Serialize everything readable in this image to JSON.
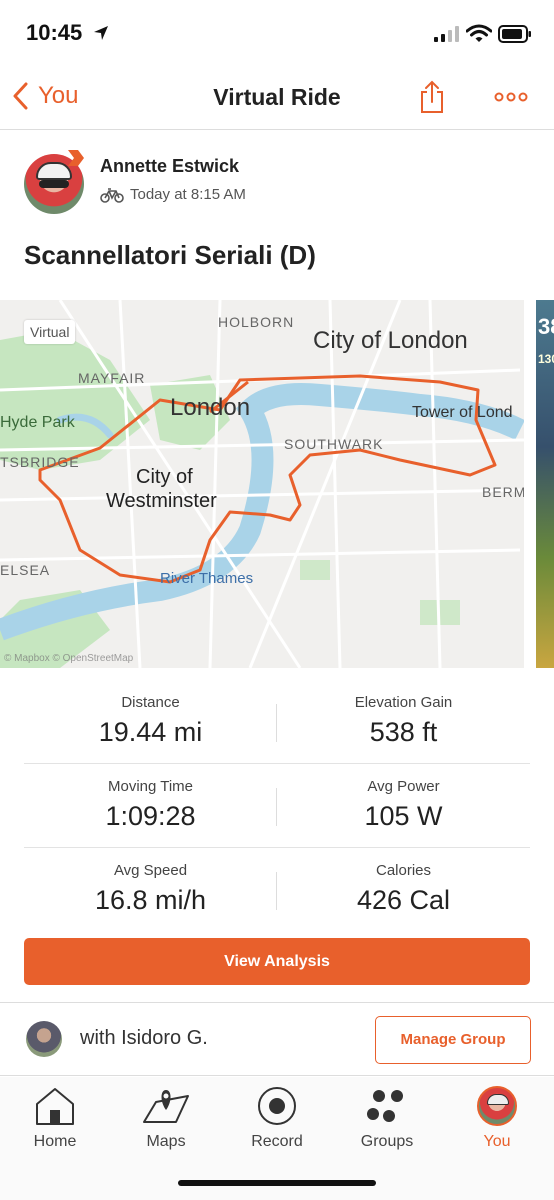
{
  "status": {
    "time": "10:45"
  },
  "nav": {
    "back_label": "You",
    "title": "Virtual Ride"
  },
  "athlete": {
    "name": "Annette Estwick",
    "when": "Today at 8:15 AM"
  },
  "activity_title": "Scannellatori Seriali (D)",
  "map": {
    "tag": "Virtual",
    "labels": {
      "holborn": "HOLBORN",
      "city_of_london": "City of London",
      "mayfair": "MAYFAIR",
      "london": "London",
      "tower": "Tower of Lond",
      "hyde_park": "Hyde Park",
      "southwark": "SOUTHWARK",
      "knightsbridge": "TSBRIDGE",
      "westminster_1": "City of",
      "westminster_2": "Westminster",
      "bermondsey": "BERM",
      "chelsea": "ELSEA",
      "river": "River Thames"
    },
    "attribution": "© Mapbox © OpenStreetMap",
    "route_color": "#e8602c",
    "peek": {
      "top": "38",
      "bottom": "130"
    }
  },
  "stats": [
    {
      "left": {
        "label": "Distance",
        "value": "19.44 mi"
      },
      "right": {
        "label": "Elevation Gain",
        "value": "538 ft"
      }
    },
    {
      "left": {
        "label": "Moving Time",
        "value": "1:09:28"
      },
      "right": {
        "label": "Avg Power",
        "value": "105 W"
      }
    },
    {
      "left": {
        "label": "Avg Speed",
        "value": "16.8 mi/h"
      },
      "right": {
        "label": "Calories",
        "value": "426 Cal"
      }
    }
  ],
  "view_analysis": "View Analysis",
  "group": {
    "with": "with Isidoro G.",
    "manage": "Manage Group"
  },
  "tabs": [
    {
      "label": "Home",
      "icon": "home-icon"
    },
    {
      "label": "Maps",
      "icon": "map-icon"
    },
    {
      "label": "Record",
      "icon": "record-icon"
    },
    {
      "label": "Groups",
      "icon": "groups-icon"
    },
    {
      "label": "You",
      "icon": "avatar"
    }
  ],
  "colors": {
    "accent": "#e8602c",
    "water": "#a9d3e8",
    "park": "#c6e6c0"
  }
}
